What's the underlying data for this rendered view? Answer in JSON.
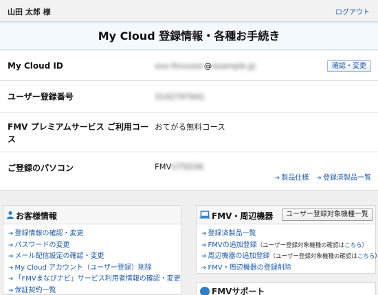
{
  "header": {
    "user_name": "山田 太郎 様",
    "logout": "ログアウト"
  },
  "page": {
    "title": "My Cloud 登録情報・各種お手続き"
  },
  "account": {
    "rows": [
      {
        "label": "My Cloud ID",
        "value_blurred": "xxx-fmvuser",
        "value_suffix": "@",
        "value_blurred2": "example.jp",
        "button": "確認・変更"
      },
      {
        "label": "ユーザー登録番号",
        "value_blurred": "3142797641"
      },
      {
        "label": "FMV プレミアムサービス ご利用コース",
        "value": "おてがる無料コース"
      },
      {
        "label": "ご登録のパソコン",
        "value_prefix": "FMV",
        "value_blurred": "U75D36",
        "links": [
          "製品仕様",
          "登録済製品一覧"
        ]
      }
    ]
  },
  "customer_panel": {
    "title": "お客様情報",
    "items": [
      "登録情報の確認・変更",
      "パスワードの変更",
      "メール配信設定の確認・変更",
      "My Cloud アカウント（ユーザー登録）削除",
      "「FMVまなびナビ」サービス利用者情報の確認・変更",
      "保証契約一覧"
    ]
  },
  "device_panel": {
    "title": "FMV・周辺機器",
    "button": "ユーザー登録対象機種一覧",
    "items": [
      {
        "text": "登録済製品一覧"
      },
      {
        "text": "FMVの追加登録",
        "note": "（ユーザー登録対象機種の確認は",
        "note_link": "こちら",
        "note_end": "）"
      },
      {
        "text": "周辺機器の追加登録",
        "note": "（ユーザー登録対象機種の確認は",
        "note_link": "こちら",
        "note_end": "）"
      },
      {
        "text": "FMV・周辺機器の登録削除"
      }
    ]
  },
  "support_panel": {
    "title": "FMVサポート"
  },
  "colors": {
    "link": "#1f5aa8",
    "title_band_bg": "#f3f9fd",
    "icon_blue": "#2f7fc8"
  }
}
